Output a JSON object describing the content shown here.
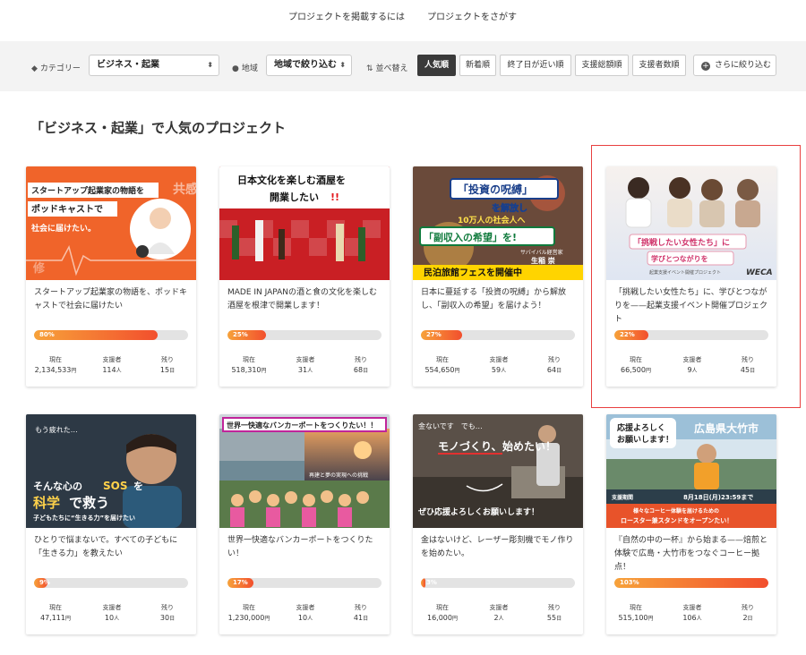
{
  "top_nav": {
    "post_project": "プロジェクトを掲載するには",
    "find_project": "プロジェクトをさがす"
  },
  "filters": {
    "category_label": "カテゴリー",
    "category_value": "ビジネス・起業",
    "region_label": "地域",
    "region_value": "地域で絞り込む",
    "sort_label": "並べ替え",
    "sort_options": [
      "人気順",
      "新着順",
      "終了日が近い順",
      "支援総額順",
      "支援者数順"
    ],
    "more_filters": "さらに絞り込む"
  },
  "section_heading": "「ビジネス・起業」で人気のプロジェクト",
  "stat_labels": {
    "current": "現在",
    "supporters": "支援者",
    "remaining": "残り"
  },
  "colors": {
    "accent": "#f24f2d",
    "progress_start": "#f7a23a",
    "highlight_box": "#e84040"
  },
  "cards": [
    {
      "title": "スタートアップ起業家の物語を、ポッドキャストで社会に届けたい",
      "image_text": [
        "スタートアップ起業家の物語を",
        "ポッドキャストで",
        "社会に届けたい。",
        "共感",
        "修"
      ],
      "progress": 80,
      "progress_label": "80%",
      "current": "2,134,533",
      "current_unit": "円",
      "supporters": "114",
      "supporters_unit": "人",
      "remaining": "15",
      "remaining_unit": "日"
    },
    {
      "title": "MADE IN JAPANの酒と食の文化を楽しむ酒屋を根津で開業します！",
      "image_text": [
        "日本文化を楽しむ酒屋を",
        "開業したい",
        "!!"
      ],
      "progress": 25,
      "progress_label": "25%",
      "current": "518,310",
      "current_unit": "円",
      "supporters": "31",
      "supporters_unit": "人",
      "remaining": "68",
      "remaining_unit": "日"
    },
    {
      "title": "日本に蔓延する「投資の呪縛」から解放し、「副収入の希望」を届けよう！",
      "image_text": [
        "「投資の呪縛」",
        "を解放し",
        "10万人の社会人へ",
        "「副収入の希望」を!",
        "サバイバル経営家",
        "生稲 崇",
        "民泊旅館フェスを開催中"
      ],
      "progress": 27,
      "progress_label": "27%",
      "current": "554,650",
      "current_unit": "円",
      "supporters": "59",
      "supporters_unit": "人",
      "remaining": "64",
      "remaining_unit": "日"
    },
    {
      "title": "「挑戦したい女性たち」に、学びとつながりを——起業支援イベント開催プロジェクト",
      "image_text": [
        "「挑戦したい女性たち」に",
        "学びとつながりを",
        "起業支援イベント開催プロジェクト",
        "WECA"
      ],
      "progress": 22,
      "progress_label": "22%",
      "current": "66,500",
      "current_unit": "円",
      "supporters": "9",
      "supporters_unit": "人",
      "remaining": "45",
      "remaining_unit": "日"
    },
    {
      "title": "ひとりで悩まないで。すべての子どもに「生きる力」を教えたい",
      "image_text": [
        "もう疲れた…",
        "そんな心の",
        "SOS",
        "を",
        "科学",
        "で救う",
        "子どもたちに“生きる力”を届けたい"
      ],
      "progress": 9,
      "progress_label": "9%",
      "current": "47,111",
      "current_unit": "円",
      "supporters": "10",
      "supporters_unit": "人",
      "remaining": "30",
      "remaining_unit": "日"
    },
    {
      "title": "世界一快適なバンカーポートをつくりたい！",
      "image_text": [
        "世界一快適なバンカーポートをつくりたい！！",
        "再建と夢の実現への挑戦"
      ],
      "progress": 17,
      "progress_label": "17%",
      "current": "1,230,000",
      "current_unit": "円",
      "supporters": "10",
      "supporters_unit": "人",
      "remaining": "41",
      "remaining_unit": "日"
    },
    {
      "title": "金はないけど、レーザー彫刻機でモノ作りを始めたい。",
      "image_text": [
        "金ないです　でも…",
        "モノづくり、",
        "始めたい！",
        "ぜひ応援よろしくお願いします！"
      ],
      "progress": 3,
      "progress_label": "3%",
      "current": "16,000",
      "current_unit": "円",
      "supporters": "2",
      "supporters_unit": "人",
      "remaining": "55",
      "remaining_unit": "日"
    },
    {
      "title": "『自然の中の一杯』から始まる——焙煎と体験で広島・大竹市をつなぐコーヒー拠点！",
      "image_text": [
        "広島県大竹市",
        "応援よろしく",
        "お願いします！",
        "支援期間",
        "8月18日(月)23:59まで",
        "様々なコーヒー体験を届けるための",
        "ロースター兼スタンドをオープンたい！"
      ],
      "progress": 103,
      "progress_label": "103%",
      "current": "515,100",
      "current_unit": "円",
      "supporters": "106",
      "supporters_unit": "人",
      "remaining": "2",
      "remaining_unit": "日"
    }
  ]
}
